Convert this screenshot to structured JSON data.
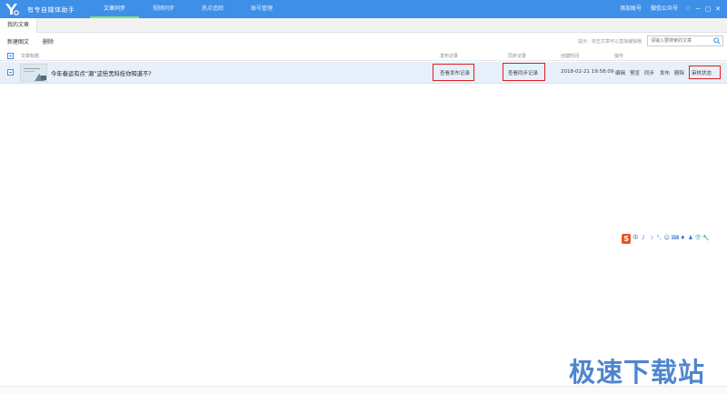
{
  "app": {
    "title": "有专自媒体助手",
    "nav_tabs": [
      "文章同步",
      "视频同步",
      "热点追踪",
      "账号管理"
    ],
    "active_tab_index": 0,
    "top_links": [
      "添加账号",
      "微信公众号"
    ],
    "window_controls": [
      "♡",
      "－",
      "▢",
      "✕"
    ],
    "accent_color": "#3d8fe8"
  },
  "section": {
    "tab_label": "我的文章"
  },
  "toolbar": {
    "new_label": "新建图文",
    "delete_label": "删除",
    "hint": "提示：双击文章可以直接编辑哦",
    "search_placeholder": "请输入要搜索的文章"
  },
  "table": {
    "columns": {
      "title": "文章标题",
      "publish": "发布记录",
      "sync": "同步记录",
      "created": "创建时间",
      "ops": "操作"
    },
    "rows": [
      {
        "title": "今年春运有点“潮”这些黑科技你知道不?",
        "publish_btn": "查看发布记录",
        "sync_btn": "查看同步记录",
        "created": "2018-02-21 19:58:09",
        "actions": [
          "编辑",
          "预览",
          "同步",
          "发布",
          "删除",
          "审核状态"
        ]
      }
    ]
  },
  "ime": {
    "logo": "S",
    "items": [
      "中",
      "丿",
      "☽",
      "°,",
      "☺",
      "⌨",
      "♦",
      "♟",
      "👕",
      "🔧"
    ]
  },
  "watermark": "极速下载站"
}
